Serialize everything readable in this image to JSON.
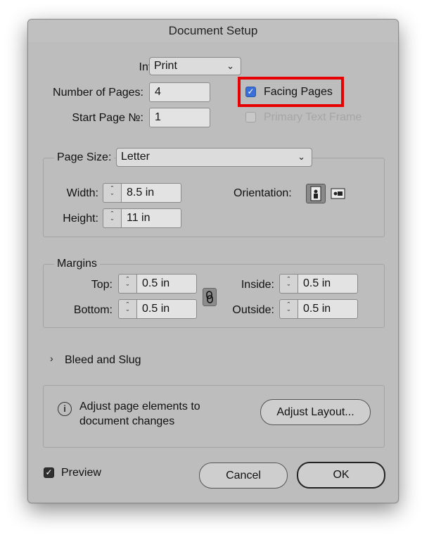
{
  "dialog": {
    "title": "Document Setup"
  },
  "intent": {
    "label": "Intent:",
    "value": "Print"
  },
  "pages": {
    "label": "Number of Pages:",
    "value": "4"
  },
  "start_page": {
    "label": "Start Page №:",
    "value": "1"
  },
  "facing_pages": {
    "label": "Facing Pages",
    "checked": true
  },
  "primary_text_frame": {
    "label": "Primary Text Frame",
    "checked": false,
    "disabled": true
  },
  "page_size": {
    "label": "Page Size:",
    "value": "Letter",
    "width_label": "Width:",
    "width": "8.5 in",
    "height_label": "Height:",
    "height": "11 in",
    "orientation_label": "Orientation:",
    "orientation": "portrait"
  },
  "margins": {
    "label": "Margins",
    "top_label": "Top:",
    "top": "0.5 in",
    "bottom_label": "Bottom:",
    "bottom": "0.5 in",
    "inside_label": "Inside:",
    "inside": "0.5 in",
    "outside_label": "Outside:",
    "outside": "0.5 in",
    "linked": true
  },
  "bleed": {
    "label": "Bleed and Slug",
    "expanded": false
  },
  "adjust": {
    "text_line1": "Adjust page elements to",
    "text_line2": "document changes",
    "button": "Adjust Layout..."
  },
  "preview": {
    "label": "Preview",
    "checked": true
  },
  "buttons": {
    "cancel": "Cancel",
    "ok": "OK"
  },
  "colors": {
    "highlight": "#e60000",
    "checkbox_accent": "#3a6fd8",
    "dialog_bg": "#bdbdbd"
  },
  "icons": {
    "chevron": "chevron-down-icon",
    "stepper": "stepper-icon",
    "link": "chain-link-icon",
    "info": "info-icon",
    "disclosure": "chevron-right-icon"
  }
}
